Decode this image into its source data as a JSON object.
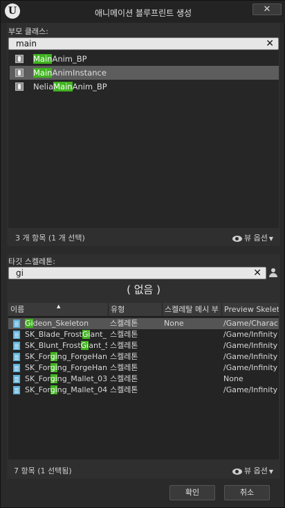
{
  "window": {
    "title": "애니메이션 블루프린트 생성",
    "close_label": "✕"
  },
  "parent_class": {
    "label": "부모 클래스:",
    "search_value": "main",
    "items": [
      {
        "prefix": "",
        "match": "Main",
        "suffix": "Anim_BP",
        "selected": false
      },
      {
        "prefix": "",
        "match": "Main",
        "suffix": "AnimInstance",
        "selected": true
      },
      {
        "prefix": "Nelia",
        "match": "Main",
        "suffix": "Anim_BP",
        "selected": false
      }
    ],
    "count": "3 개 항목 (1 개 선택)",
    "view_options": "뷰 옵션"
  },
  "target_skeleton": {
    "label": "타깃 스켈레톤:",
    "search_value": "gi",
    "none_label": "( 없음 )",
    "columns": [
      "이름",
      "유형",
      "스켈레탈 메시 부",
      "Preview Skeleta"
    ],
    "rows": [
      {
        "name_prefix": "",
        "name_match": "Gi",
        "name_suffix": "deon_Skeleton",
        "type": "스켈레톤",
        "mesh": "None",
        "preview": "/Game/Charac",
        "selected": true
      },
      {
        "name_prefix": "SK_Blade_Frost",
        "name_match": "Gi",
        "name_suffix": "ant_",
        "type": "스켈레톤",
        "mesh": "",
        "preview": "/Game/Infinity",
        "selected": false
      },
      {
        "name_prefix": "SK_Blunt_Frost",
        "name_match": "Gi",
        "name_suffix": "ant_S",
        "type": "스켈레톤",
        "mesh": "",
        "preview": "/Game/Infinity",
        "selected": false
      },
      {
        "name_prefix": "SK_For",
        "name_match": "gi",
        "name_suffix": "ng_ForgeHan",
        "type": "스켈레톤",
        "mesh": "",
        "preview": "/Game/Infinity",
        "selected": false
      },
      {
        "name_prefix": "SK_For",
        "name_match": "gi",
        "name_suffix": "ng_ForgeHan",
        "type": "스켈레톤",
        "mesh": "",
        "preview": "/Game/Infinity",
        "selected": false
      },
      {
        "name_prefix": "SK_For",
        "name_match": "gi",
        "name_suffix": "ng_Mallet_03",
        "type": "스켈레톤",
        "mesh": "",
        "preview": "None",
        "selected": false
      },
      {
        "name_prefix": "SK_For",
        "name_match": "gi",
        "name_suffix": "ng_Mallet_04",
        "type": "스켈레톤",
        "mesh": "",
        "preview": "/Game/Infinity",
        "selected": false
      }
    ],
    "count": "7 항목 (1 선택됨)",
    "view_options": "뷰 옵션"
  },
  "buttons": {
    "ok": "확인",
    "cancel": "취소"
  },
  "colors": {
    "highlight": "#3fb31e",
    "selection": "#5d5d5d",
    "skeleton_icon": "#5fb1d9"
  }
}
